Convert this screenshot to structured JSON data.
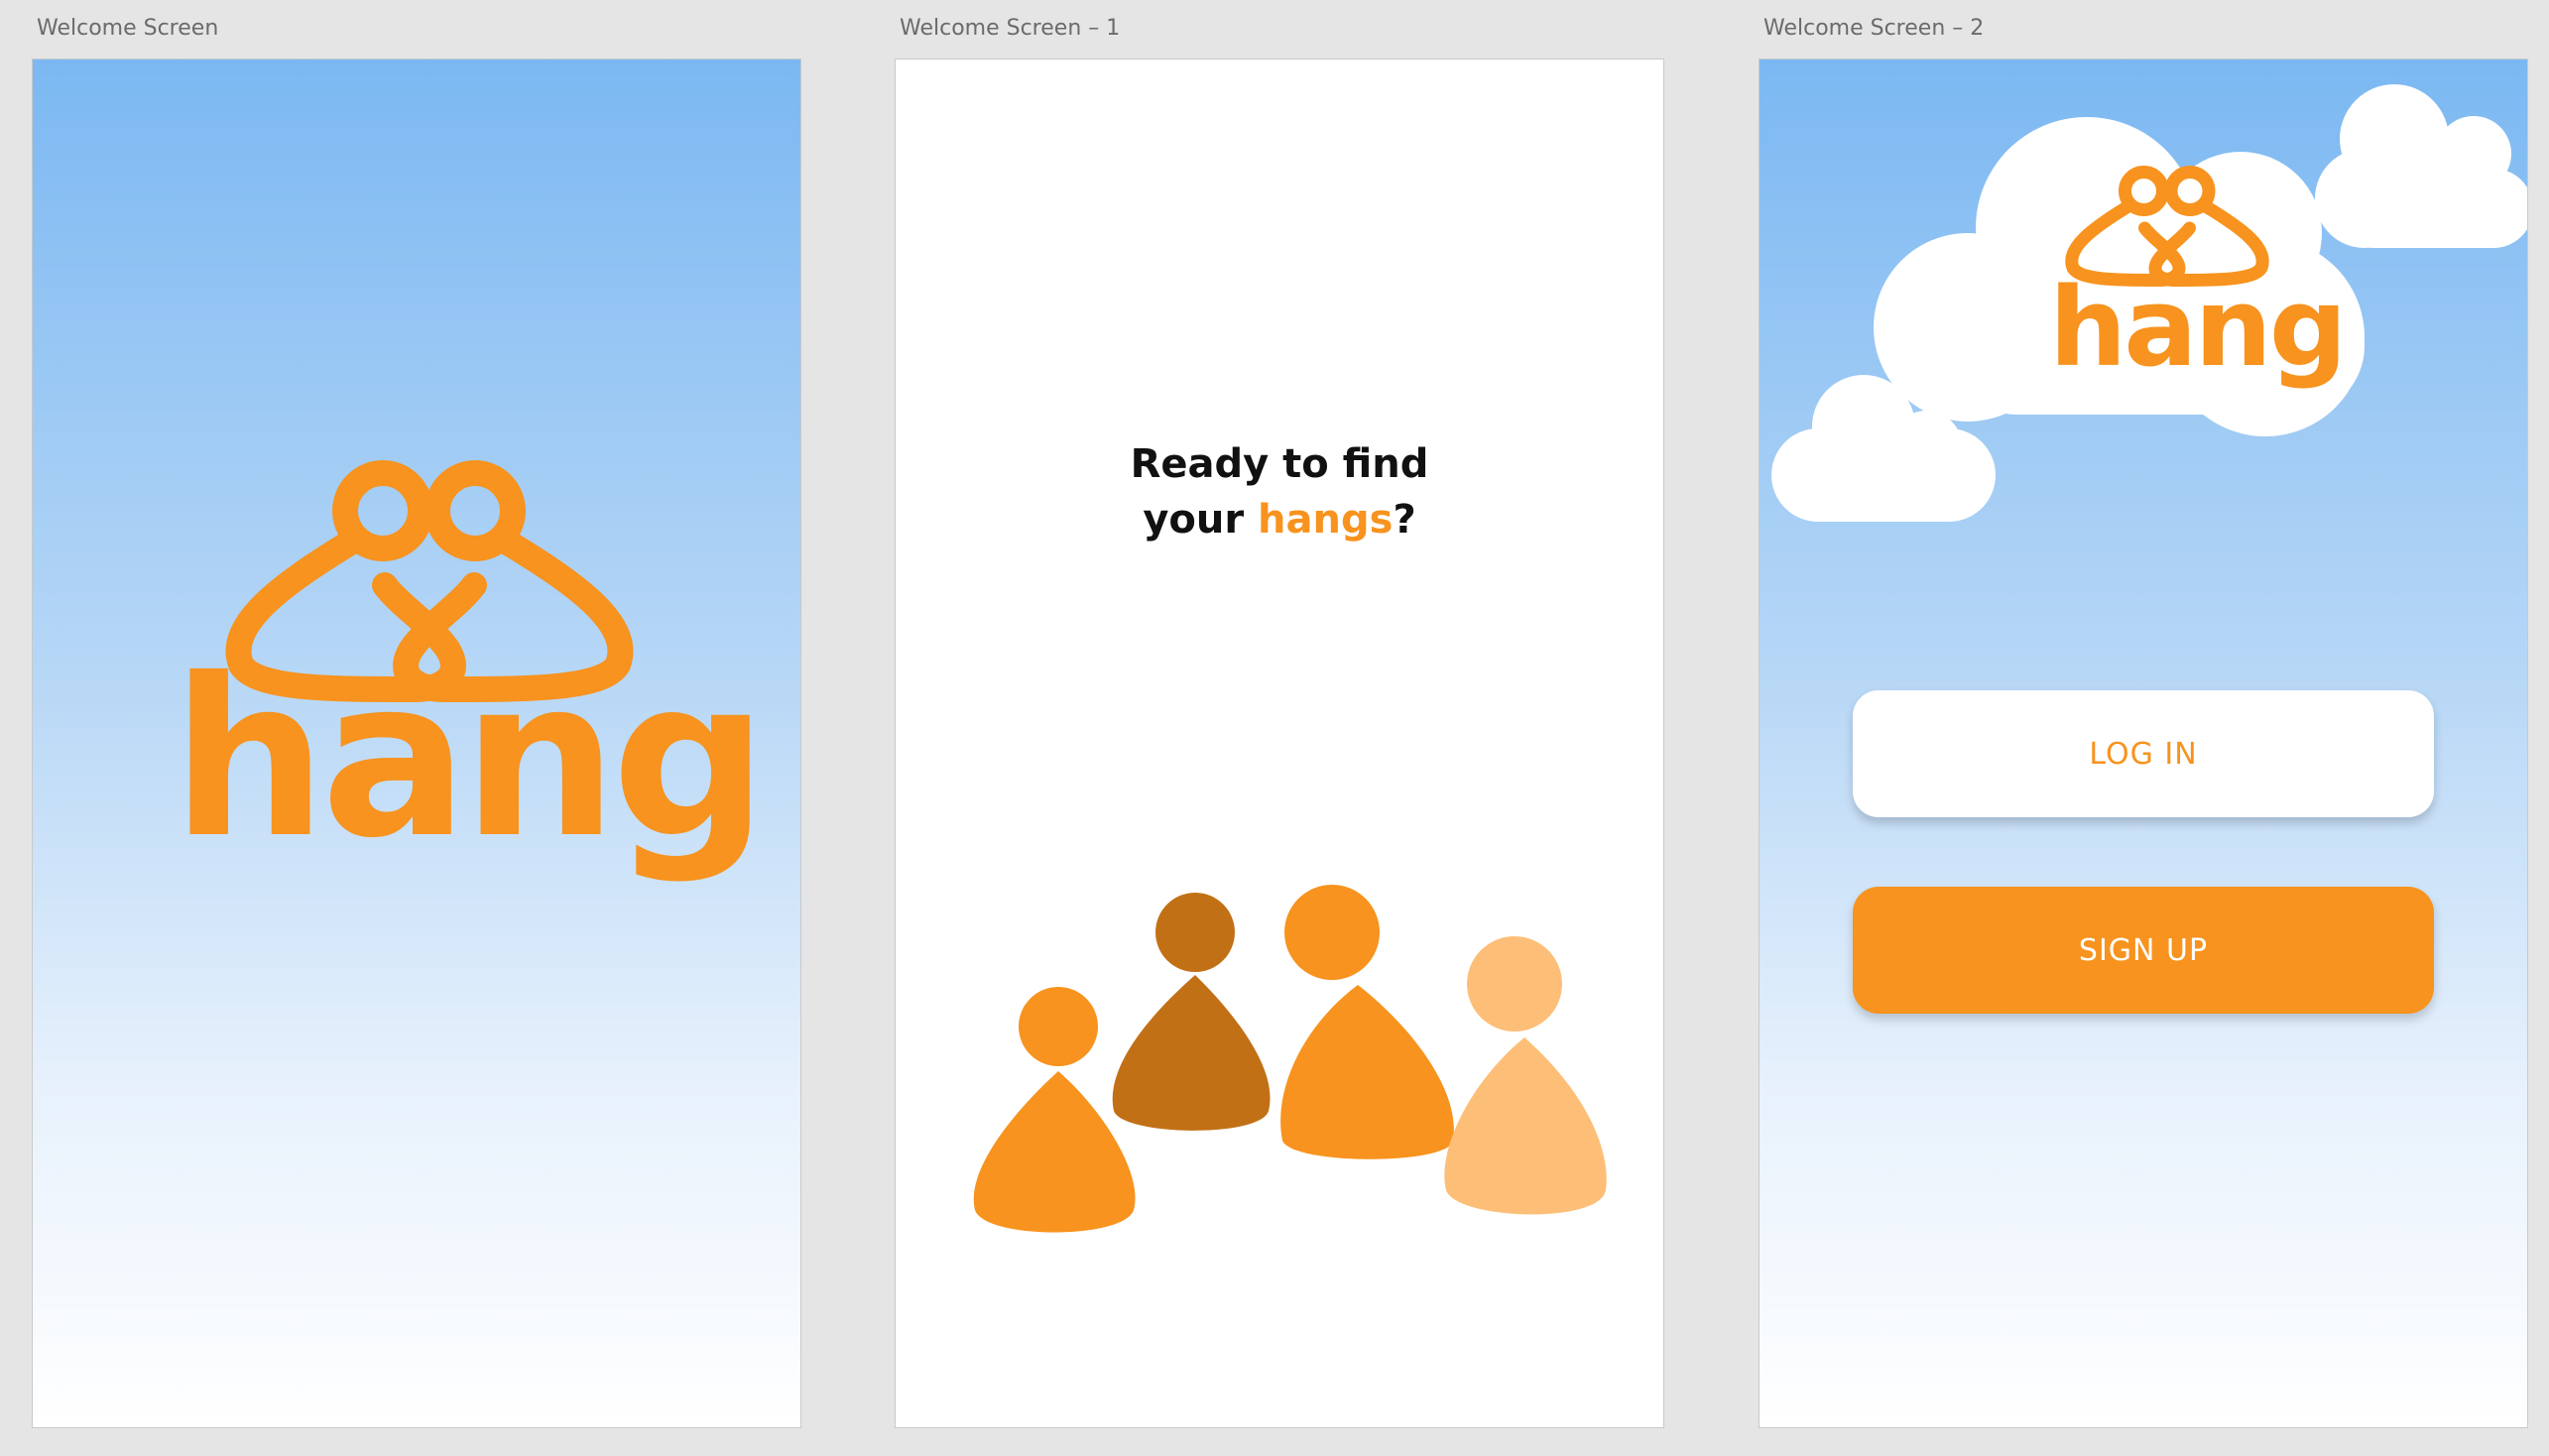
{
  "artboards": [
    {
      "title": "Welcome Screen"
    },
    {
      "title": "Welcome Screen – 1"
    },
    {
      "title": "Welcome Screen – 2"
    }
  ],
  "brand": {
    "wordmark": "hang",
    "accent_color": "#f7931e",
    "dark_orange": "#c27016",
    "light_orange": "#fdbf78",
    "sky_top": "#7bb8f2",
    "sky_bottom": "#ffffff"
  },
  "welcome_1": {
    "line1": "Ready to find",
    "line2_pre": "your ",
    "line2_accent": "hangs",
    "line2_post": "?"
  },
  "welcome_2": {
    "login_label": "LOG IN",
    "signup_label": "SIGN UP"
  },
  "icons": [
    "hang-logo-icon",
    "people-illustration",
    "cloud-icon"
  ]
}
